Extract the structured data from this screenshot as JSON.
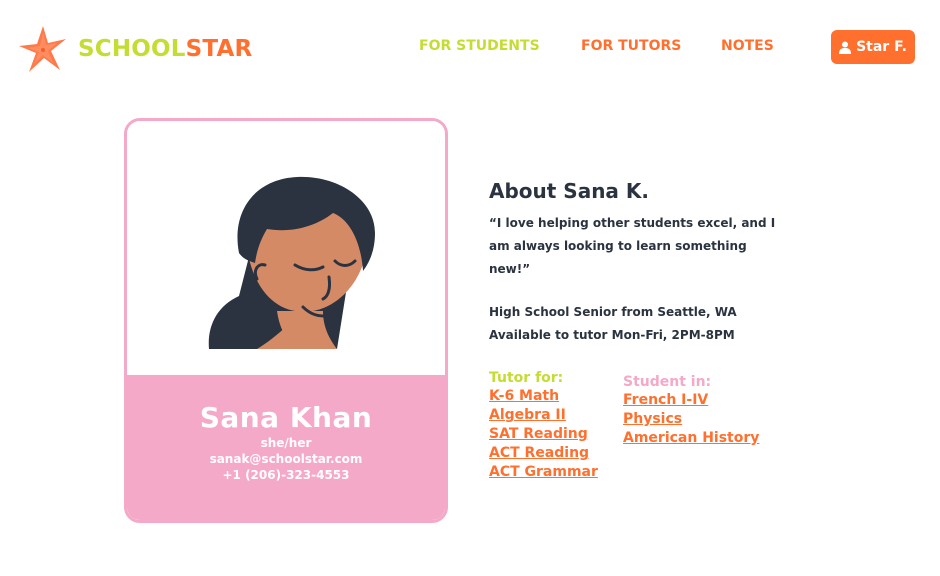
{
  "header": {
    "brand_part1": "SCHOOL",
    "brand_part2": "STAR",
    "nav": [
      {
        "label": "FOR STUDENTS"
      },
      {
        "label": "FOR TUTORS"
      },
      {
        "label": "NOTES"
      }
    ],
    "user_button_label": "Star F."
  },
  "profile": {
    "name": "Sana Khan",
    "pronouns": "she/her",
    "email": "sanak@schoolstar.com",
    "phone": "+1 (206)-323-4553"
  },
  "about": {
    "title": "About Sana K.",
    "quote_line1": "“I  love helping other students excel, and I",
    "quote_line2": "am always looking to learn something new!”",
    "detail_line1": "High School Senior from Seattle, WA",
    "detail_line2": "Available to tutor Mon-Fri, 2PM-8PM"
  },
  "tutor_for": {
    "heading": "Tutor for:",
    "subjects": [
      "K-6 Math",
      "Algebra II",
      "SAT Reading",
      "ACT Reading",
      "ACT Grammar"
    ]
  },
  "student_in": {
    "heading": "Student in:",
    "subjects": [
      "French I-IV",
      "Physics",
      "American History"
    ]
  },
  "colors": {
    "brand_green": "#c5dc33",
    "brand_orange": "#ff6f2e",
    "card_pink": "#f4a9c8",
    "text_dark": "#2b3340"
  },
  "icons": [
    "starfish-logo-icon",
    "user-icon"
  ]
}
